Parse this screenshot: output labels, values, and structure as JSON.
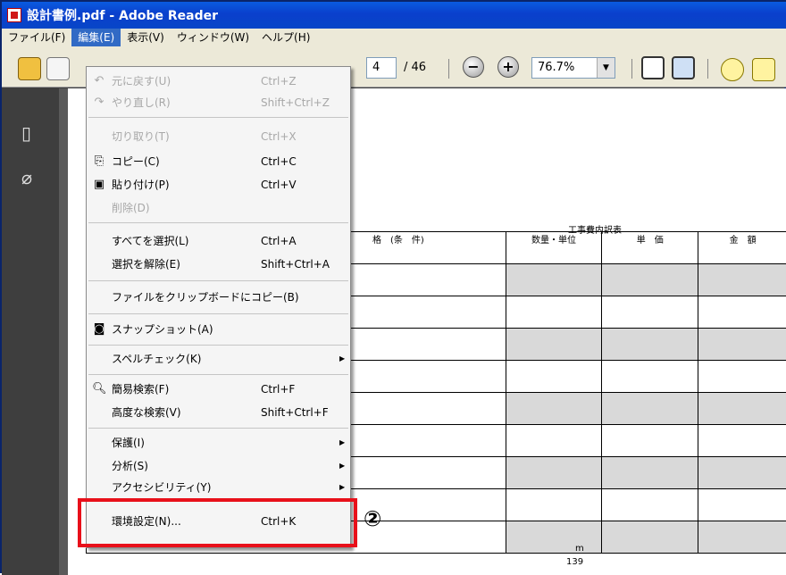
{
  "window": {
    "title": "設計書例.pdf - Adobe Reader"
  },
  "menubar": [
    "ファイル(F)",
    "編集(E)",
    "表示(V)",
    "ウィンドウ(W)",
    "ヘルプ(H)"
  ],
  "toolbar": {
    "page_current": "4",
    "page_total": "/ 46",
    "zoom": "76.7%",
    "zoom_out": "−",
    "zoom_in": "+"
  },
  "edit_menu": [
    {
      "label": "元に戻す(U)",
      "shortcut": "Ctrl+Z",
      "disabled": true,
      "icon": "undo-icon"
    },
    {
      "label": "やり直し(R)",
      "shortcut": "Shift+Ctrl+Z",
      "disabled": true,
      "icon": "redo-icon"
    },
    {
      "label": "切り取り(T)",
      "shortcut": "Ctrl+X",
      "disabled": true,
      "icon": ""
    },
    {
      "label": "コピー(C)",
      "shortcut": "Ctrl+C",
      "disabled": false,
      "icon": "copy-icon"
    },
    {
      "label": "貼り付け(P)",
      "shortcut": "Ctrl+V",
      "disabled": false,
      "icon": "paste-icon"
    },
    {
      "label": "削除(D)",
      "shortcut": "",
      "disabled": true,
      "icon": ""
    },
    {
      "label": "すべてを選択(L)",
      "shortcut": "Ctrl+A",
      "disabled": false,
      "icon": ""
    },
    {
      "label": "選択を解除(E)",
      "shortcut": "Shift+Ctrl+A",
      "disabled": false,
      "icon": ""
    },
    {
      "label": "ファイルをクリップボードにコピー(B)",
      "shortcut": "",
      "disabled": false,
      "icon": ""
    },
    {
      "label": "スナップショット(A)",
      "shortcut": "",
      "disabled": false,
      "icon": "camera-icon"
    },
    {
      "label": "スペルチェック(K)",
      "shortcut": "",
      "disabled": false,
      "icon": "",
      "submenu": true
    },
    {
      "label": "簡易検索(F)",
      "shortcut": "Ctrl+F",
      "disabled": false,
      "icon": "search-icon"
    },
    {
      "label": "高度な検索(V)",
      "shortcut": "Shift+Ctrl+F",
      "disabled": false,
      "icon": ""
    },
    {
      "label": "保護(I)",
      "shortcut": "",
      "disabled": false,
      "icon": "",
      "submenu": true
    },
    {
      "label": "分析(S)",
      "shortcut": "",
      "disabled": false,
      "icon": "",
      "submenu": true
    },
    {
      "label": "アクセシビリティ(Y)",
      "shortcut": "",
      "disabled": false,
      "icon": "",
      "submenu": true
    },
    {
      "label": "環境設定(N)...",
      "shortcut": "Ctrl+K",
      "disabled": false,
      "icon": ""
    }
  ],
  "annotation": {
    "marker": "②",
    "color": "#e8101a"
  },
  "document": {
    "table_title": "工事費内訳表",
    "headers": [
      "格　(条　件)",
      "数量・単位",
      "単　価",
      "金　額"
    ],
    "unit": "m",
    "quantity": "139"
  }
}
